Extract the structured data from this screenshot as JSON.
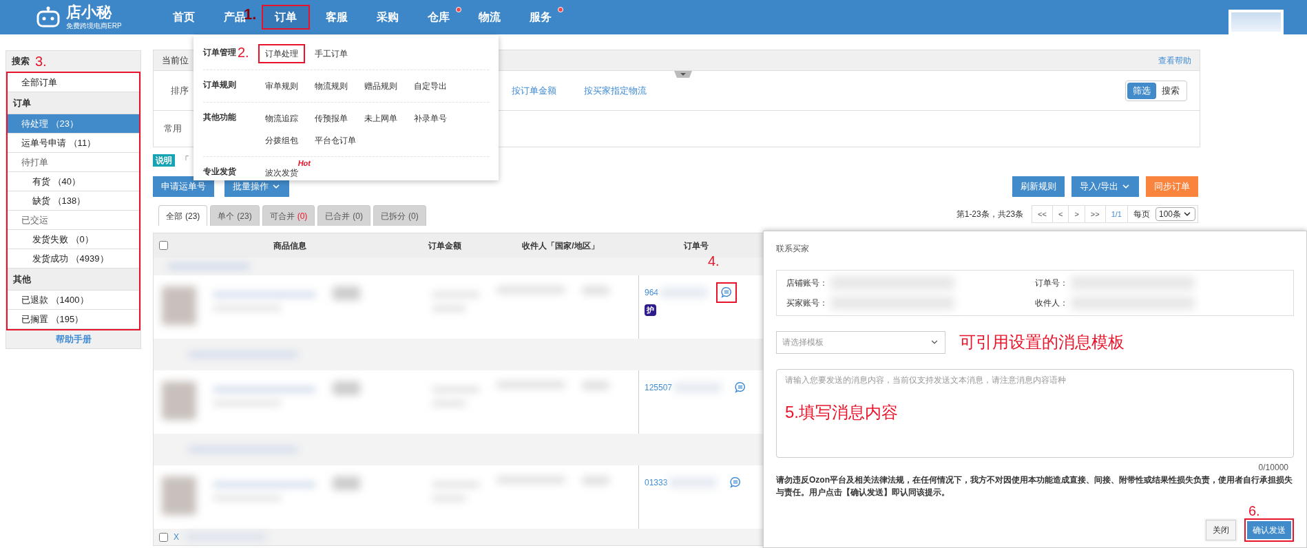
{
  "top_nav": {
    "logo_name": "店小秘",
    "logo_tagline": "免费跨境电商ERP",
    "annotation": "1.",
    "items": [
      {
        "label": "首页",
        "selected": false,
        "dot": false,
        "highlighted": false
      },
      {
        "label": "产品",
        "selected": false,
        "dot": false,
        "highlighted": false
      },
      {
        "label": "订单",
        "selected": true,
        "dot": false,
        "highlighted": true
      },
      {
        "label": "客服",
        "selected": false,
        "dot": false,
        "highlighted": false
      },
      {
        "label": "采购",
        "selected": false,
        "dot": false,
        "highlighted": false
      },
      {
        "label": "仓库",
        "selected": false,
        "dot": true,
        "highlighted": false
      },
      {
        "label": "物流",
        "selected": false,
        "dot": false,
        "highlighted": false
      },
      {
        "label": "服务",
        "selected": false,
        "dot": true,
        "highlighted": false
      }
    ]
  },
  "order_menu": {
    "annotation": "2.",
    "groups": [
      {
        "label": "订单管理",
        "links": [
          {
            "label": "订单处理",
            "highlighted": true
          },
          {
            "label": "手工订单",
            "highlighted": false
          }
        ]
      },
      {
        "label": "订单规则",
        "links": [
          {
            "label": "审单规则",
            "highlighted": false
          },
          {
            "label": "物流规则",
            "highlighted": false
          },
          {
            "label": "赠品规则",
            "highlighted": false
          },
          {
            "label": "自定导出",
            "highlighted": false
          }
        ]
      },
      {
        "label": "其他功能",
        "links": [
          {
            "label": "物流追踪",
            "highlighted": false
          },
          {
            "label": "传预报单",
            "highlighted": false
          },
          {
            "label": "未上网单",
            "highlighted": false
          },
          {
            "label": "补录单号",
            "highlighted": false
          },
          {
            "label": "分拨组包",
            "highlighted": false
          },
          {
            "label": "平台仓订单",
            "highlighted": false
          }
        ]
      },
      {
        "label": "专业发货",
        "links": [
          {
            "label": "波次发货",
            "highlighted": false,
            "badge": "Hot"
          }
        ]
      }
    ]
  },
  "sidebar": {
    "search_label": "搜索",
    "annotation": "3.",
    "highlighted": true,
    "help_link": "帮助手册",
    "sections": [
      {
        "items": [
          {
            "label": "全部订单",
            "selected": false
          }
        ]
      },
      {
        "heading": "订单",
        "items": [
          {
            "label": "待处理 （23）",
            "selected": true
          },
          {
            "label": "运单号申请 （11）",
            "selected": false
          },
          {
            "label": "待打单",
            "selected": false,
            "children": [
              {
                "label": "有货 （40）",
                "selected": false
              },
              {
                "label": "缺货 （138）",
                "selected": false
              }
            ]
          },
          {
            "label": "已交运",
            "selected": false,
            "children": [
              {
                "label": "发货失败 （0）",
                "selected": false
              },
              {
                "label": "发货成功 （4939）",
                "selected": false
              }
            ]
          }
        ]
      },
      {
        "heading": "其他",
        "items": [
          {
            "label": "已退款 （1400）",
            "selected": false
          },
          {
            "label": "已搁置 （195）",
            "selected": false
          }
        ]
      }
    ]
  },
  "breadcrumb": {
    "label": "当前位",
    "help": "查看帮助"
  },
  "filters": {
    "sort_label": "排序",
    "sort_links": [
      "按订单金额",
      "按买家指定物流"
    ],
    "common_label": "常用",
    "mode_toggle": [
      {
        "label": "筛选",
        "selected": true
      },
      {
        "label": "搜索",
        "selected": false
      }
    ]
  },
  "notice": {
    "badge": "说明",
    "text": "「"
  },
  "actions": {
    "left": [
      {
        "label": "申请运单号",
        "dropdown": false
      },
      {
        "label": "批量操作",
        "dropdown": true
      }
    ],
    "right": [
      {
        "label": "刷新规则",
        "kind": "primary",
        "dropdown": false
      },
      {
        "label": "导入/导出",
        "kind": "primary",
        "dropdown": true
      },
      {
        "label": "同步订单",
        "kind": "warning",
        "dropdown": false
      }
    ]
  },
  "tabs": [
    {
      "label": "全部",
      "count": "(23)",
      "selected": true,
      "alert": false
    },
    {
      "label": "单个",
      "count": "(23)",
      "selected": false,
      "alert": false
    },
    {
      "label": "可合并",
      "count": "(0)",
      "selected": false,
      "alert": true
    },
    {
      "label": "已合并",
      "count": "(0)",
      "selected": false,
      "alert": false
    },
    {
      "label": "已拆分",
      "count": "(0)",
      "selected": false,
      "alert": false
    }
  ],
  "pagination": {
    "summary": "第1-23条，共23条",
    "buttons": [
      {
        "label": "<<",
        "selected": false
      },
      {
        "label": "<",
        "selected": false
      },
      {
        "label": ">",
        "selected": false
      },
      {
        "label": ">>",
        "selected": false
      },
      {
        "label": "1/1",
        "selected": true
      }
    ],
    "per_page_label": "每页",
    "per_page": "100条"
  },
  "table": {
    "select_all_checked": false,
    "footer_checked": false,
    "columns": [
      "商品信息",
      "订单金额",
      "收件人「国家/地区」",
      "订单号"
    ],
    "rows": [
      {
        "order_no": "964",
        "tags": [
          "护"
        ],
        "highlighted": true,
        "annotation": "4."
      },
      {
        "order_no": "125507",
        "tags": [],
        "highlighted": false
      },
      {
        "order_no": "01333",
        "tags": [],
        "highlighted": false
      }
    ],
    "footer_link": "X"
  },
  "dialog": {
    "title": "联系买家",
    "fields": [
      "店铺账号：",
      "订单号：",
      "买家账号：",
      "收件人："
    ],
    "template_placeholder": "请选择模板",
    "template_note": "可引用设置的消息模板",
    "message_placeholder": "请输入您要发送的消息内容，当前仅支持发送文本消息，请注意消息内容语种",
    "message_note": "5.填写消息内容",
    "counter": "0/10000",
    "disclaimer": "请勿违反Ozon平台及相关法律法规，在任何情况下，我方不对因使用本功能造成直接、间接、附带性或结果性损失负责，使用者自行承担损失与责任。用户点击【确认发送】即认同该提示。",
    "annotation": "6.",
    "buttons": [
      {
        "label": "关闭",
        "kind": "secondary",
        "highlighted": false
      },
      {
        "label": "确认发送",
        "kind": "primary",
        "highlighted": true
      }
    ]
  }
}
